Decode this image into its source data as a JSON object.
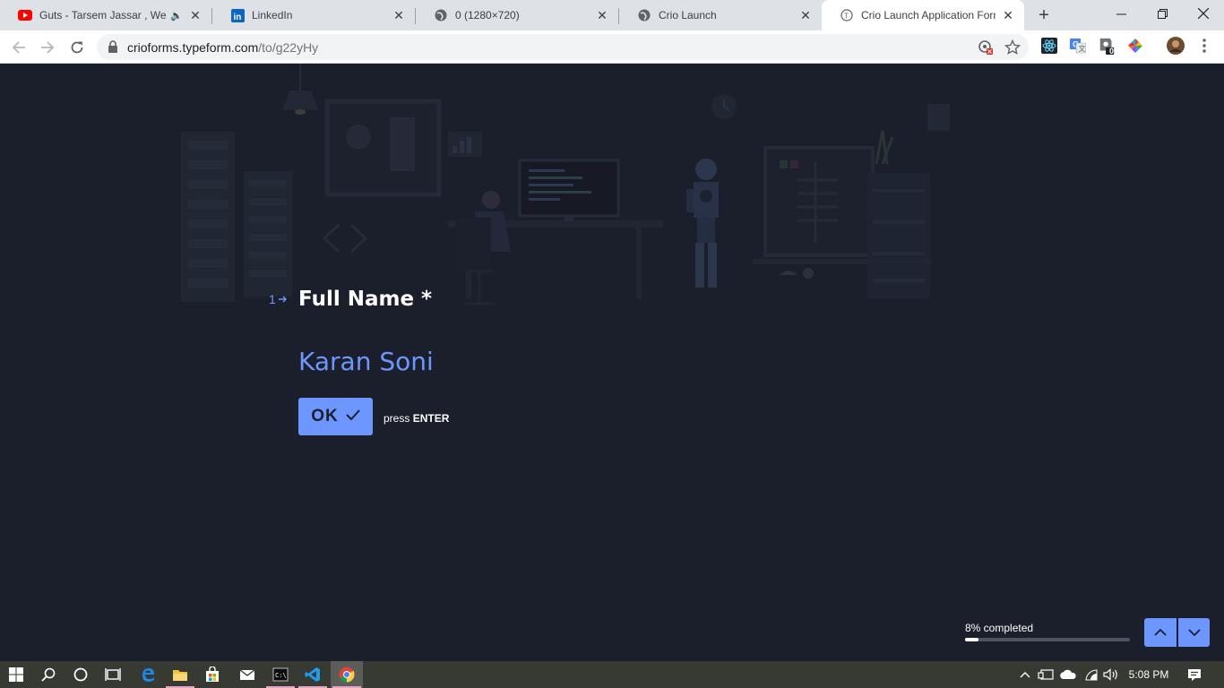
{
  "browser": {
    "tabs": [
      {
        "title": "Guts - Tarsem Jassar , West",
        "favicon": "youtube-icon",
        "audio": true
      },
      {
        "title": "LinkedIn",
        "favicon": "linkedin-icon"
      },
      {
        "title": "0 (1280×720)",
        "favicon": "globe-icon"
      },
      {
        "title": "Crio Launch",
        "favicon": "globe-icon"
      },
      {
        "title": "Crio Launch Application Form",
        "favicon": "typeform-icon",
        "active": true
      }
    ],
    "url_host": "crioforms.typeform.com",
    "url_path": "/to/g22yHy",
    "extension_badge": "0"
  },
  "form": {
    "question_number": "1",
    "question_title": "Full Name *",
    "answer_value": "Karan Soni",
    "ok_label": "OK",
    "hint_prefix": "press",
    "hint_key": "ENTER",
    "progress_label": "8% completed",
    "progress_fraction": 0.08
  },
  "taskbar": {
    "time": "5:08 PM"
  },
  "colors": {
    "page_background": "#1b1f2b",
    "accent": "#6d97ff",
    "question_text": "#ffffff"
  }
}
